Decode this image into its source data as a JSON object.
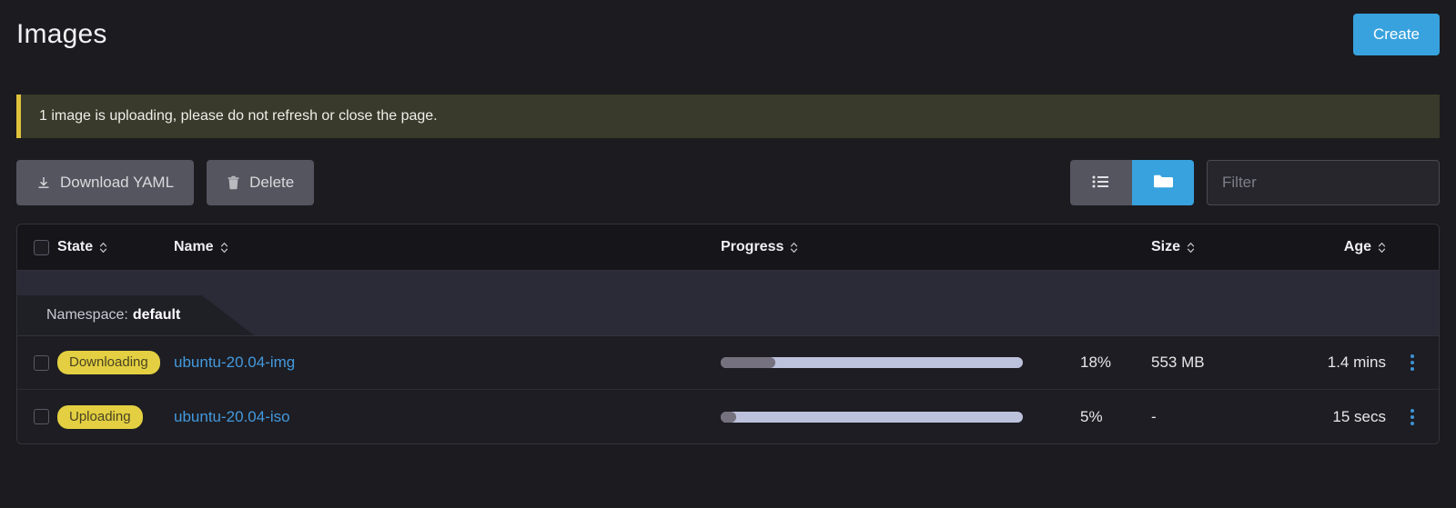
{
  "header": {
    "title": "Images",
    "create_label": "Create"
  },
  "banner": {
    "message": "1 image is uploading, please do not refresh or close the page.",
    "accent_color": "#DFC13C",
    "background": "#393A2B"
  },
  "toolbar": {
    "download_yaml_label": "Download YAML",
    "download_icon": "download-icon",
    "delete_label": "Delete",
    "delete_icon": "trash-icon",
    "view_flat_icon": "list-icon",
    "view_group_icon": "folder-icon",
    "view_active": "group",
    "filter_placeholder": "Filter",
    "filter_value": "",
    "accent_color": "#38A2DE"
  },
  "table": {
    "columns": [
      {
        "key": "state",
        "label": "State",
        "sortable": true
      },
      {
        "key": "name",
        "label": "Name",
        "sortable": true
      },
      {
        "key": "progress",
        "label": "Progress",
        "sortable": true
      },
      {
        "key": "size",
        "label": "Size",
        "sortable": true
      },
      {
        "key": "age",
        "label": "Age",
        "sortable": true
      }
    ],
    "group": {
      "label": "Namespace:",
      "value": "default"
    },
    "rows": [
      {
        "state": "Downloading",
        "name": "ubuntu-20.04-img",
        "progress_percent": 18,
        "progress_label": "18%",
        "size": "553 MB",
        "age": "1.4 mins"
      },
      {
        "state": "Uploading",
        "name": "ubuntu-20.04-iso",
        "progress_percent": 5,
        "progress_label": "5%",
        "size": "-",
        "age": "15 secs"
      }
    ],
    "badge_color": "#E3CF41",
    "link_color": "#4499DD",
    "progress_track_color": "#BDC2DC",
    "progress_fill_color": "#75717E"
  }
}
